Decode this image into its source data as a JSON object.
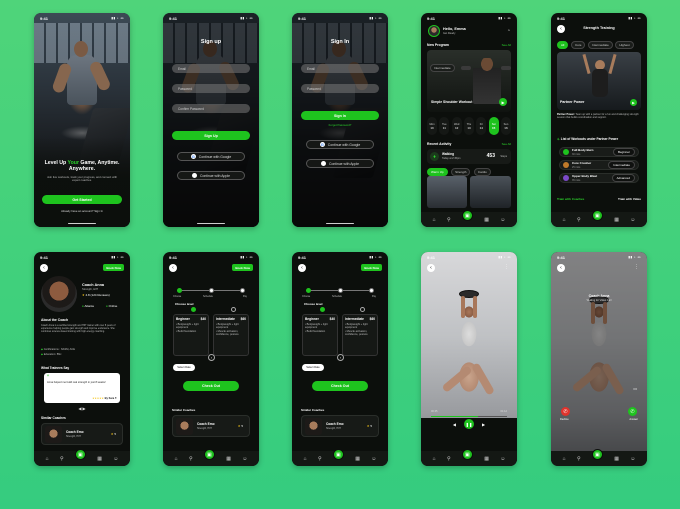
{
  "status_time": "9:41",
  "welcome": {
    "headline_a": "Level Up ",
    "headline_b": "Your",
    "headline_c": " Game, Anytime. Anywhere.",
    "sub": "Join live workouts, track your progress, and connect with expert coaches.",
    "cta": "Get Started",
    "account": "Already have an account? Sign In"
  },
  "signup": {
    "title": "Sign up",
    "email": "Email",
    "password": "Password",
    "confirm": "Confirm Password",
    "cta": "Sign Up",
    "google": "Continue with Google",
    "apple": "Continue with Apple"
  },
  "signin": {
    "title": "Sign In",
    "email": "Email",
    "password": "Password",
    "forgot": "Forgot Password?",
    "cta": "Sign In",
    "google": "Continue with Google",
    "apple": "Continue with Apple"
  },
  "home": {
    "greeting": "Hello, Emma",
    "sub": "Get Ready",
    "new_program": "New Program",
    "see_all": "See All",
    "program_level": "Intermediate",
    "program_name": "Simple Shoulder Workout",
    "days": [
      "Mon",
      "Tue",
      "Wed",
      "Thu",
      "Fri",
      "Sat",
      "Sun"
    ],
    "dates": [
      "10",
      "11",
      "12",
      "13",
      "14",
      "15",
      "16"
    ],
    "recent_activity": "Recent Activity",
    "walking": "Walking",
    "walking_sub": "Today at 2:45pm",
    "steps": "453",
    "steps_unit": "Steps",
    "chips": [
      "Warm Up",
      "Strength",
      "Cardio"
    ]
  },
  "strength": {
    "title": "Strength Training",
    "filters": [
      "All",
      "Core",
      "Intermediate",
      "Highest"
    ],
    "featured_name": "Partner Power",
    "featured_desc_bold": "Partner Power:",
    "featured_desc": " Team up with a partner for a fun and challenging strength session that builds coordination and support.",
    "list_title": "List of Workouts under Partner Power",
    "workouts": [
      {
        "name": "Full Body Burn",
        "sub": "30 mins",
        "level": "Beginner"
      },
      {
        "name": "Core Crusher",
        "sub": "25 mins",
        "level": "Intermediate"
      },
      {
        "name": "Upper Body Blast",
        "sub": "35 mins",
        "level": "Advanced"
      }
    ],
    "train_coaches": "Train with Coaches",
    "train_video": "Train with Video"
  },
  "coach": {
    "book": "Book Now",
    "name": "Coach Anna",
    "specialty": "Strength, HIIT",
    "rating": "4.8 (124 Reviews)",
    "location": "Atlanta",
    "online": "Online",
    "about_title": "About the Coach",
    "about": "Coach Anna is a certified strength and HIIT trainer with over 8 years of experience helping people gain strength and improve endurance. She combines science-based training with high-energy coaching.",
    "certs": "Certifications : NASM, ACE",
    "education": "Education: BSc",
    "trainees_title": "What Trainees Say",
    "testimonial": "Anna helped me build real strength in just 8 weeks!",
    "reviewer": "By Sara T.",
    "similar": "Similar Coaches",
    "similar_name": "Coach Emo",
    "similar_sub": "Strength, HIIT",
    "similar_rating": "5"
  },
  "booking": {
    "book": "Book Now",
    "steps": [
      "Choose",
      "Schedule",
      "Pay"
    ],
    "choose_level": "Choose level",
    "plans": [
      {
        "name": "Beginner",
        "price": "$40",
        "lines": [
          "Bodyweight + light equipment",
          "Build foundation"
        ]
      },
      {
        "name": "Intermediate",
        "price": "$60",
        "lines": [
          "Bodyweight + light equipment",
          "Muscle activation, confidence, posture"
        ]
      }
    ],
    "select_date": "Select Date",
    "cta": "Check Out",
    "similar": "Similar Coaches",
    "similar_name": "Coach Emo",
    "similar_sub": "Strength, HIIT",
    "similar_rating": "5"
  },
  "video": {
    "time_start": "00:45",
    "time_end": "01:12"
  },
  "call": {
    "name": "Coach Anna",
    "status": "Waiting for Video Call",
    "decline": "Decline",
    "accept": "Answer"
  },
  "colors": {
    "accent": "#1ec31e",
    "background": "#3fd07c"
  }
}
